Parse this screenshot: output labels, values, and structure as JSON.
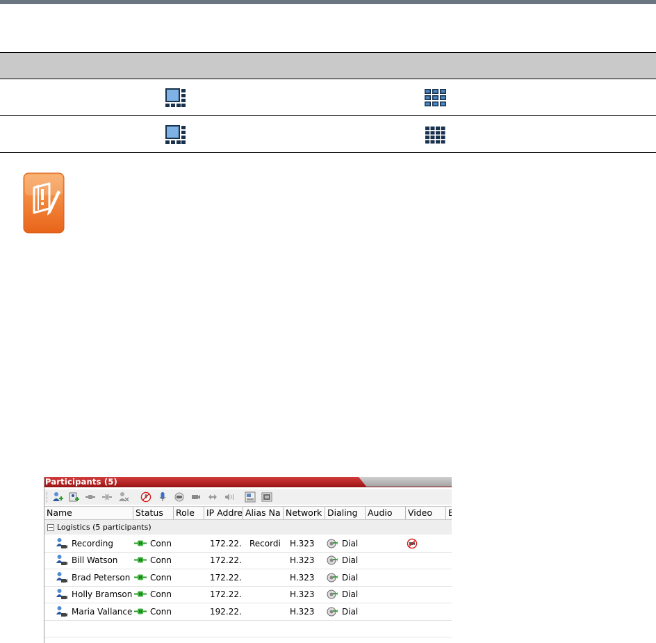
{
  "layout_table": {
    "rows": [
      {
        "icon_1": "large-plus-strip-layout-icon",
        "icon_2": "grid-3x3-layout-icon"
      },
      {
        "icon_1": "large-plus-strip-layout-icon",
        "icon_2": "grid-4x4-layout-icon"
      }
    ]
  },
  "note": {
    "icon": "note-warning-icon",
    "color": "#f47b20"
  },
  "participants_panel": {
    "title": "Participants (5)",
    "title_color": "#b51a1a",
    "toolbar_icons": [
      "add-participant-icon",
      "add-from-address-book-icon",
      "connect-icon",
      "disconnect-icon",
      "delete-participant-icon",
      "mute-audio-icon",
      "microphone-icon",
      "suspend-video-icon",
      "video-icon",
      "change-role-icon",
      "audio-volume-icon",
      "layout-icon",
      "video-settings-icon"
    ],
    "columns": [
      "Name",
      "Status",
      "Role",
      "IP Addre",
      "Alias Na",
      "Network",
      "Dialing",
      "Audio",
      "Video",
      "E"
    ],
    "group": {
      "label": "Logistics (5  participants)"
    },
    "rows": [
      {
        "name": "Recording",
        "status": "Conn",
        "role": "",
        "ip": "172.22.",
        "alias": "Recordi",
        "network": "H.323",
        "dialing": "Dial",
        "video_icon": "video-muted-icon"
      },
      {
        "name": "Bill Watson",
        "status": "Conn",
        "role": "",
        "ip": "172.22.",
        "alias": "",
        "network": "H.323",
        "dialing": "Dial",
        "video_icon": ""
      },
      {
        "name": "Brad Peterson",
        "status": "Conn",
        "role": "",
        "ip": "172.22.",
        "alias": "",
        "network": "H.323",
        "dialing": "Dial",
        "video_icon": ""
      },
      {
        "name": "Holly Bramson",
        "status": "Conn",
        "role": "",
        "ip": "172.22.",
        "alias": "",
        "network": "H.323",
        "dialing": "Dial",
        "video_icon": ""
      },
      {
        "name": "Maria Vallance",
        "status": "Conn",
        "role": "",
        "ip": "192.22.",
        "alias": "",
        "network": "H.323",
        "dialing": "Dial",
        "video_icon": ""
      }
    ]
  }
}
